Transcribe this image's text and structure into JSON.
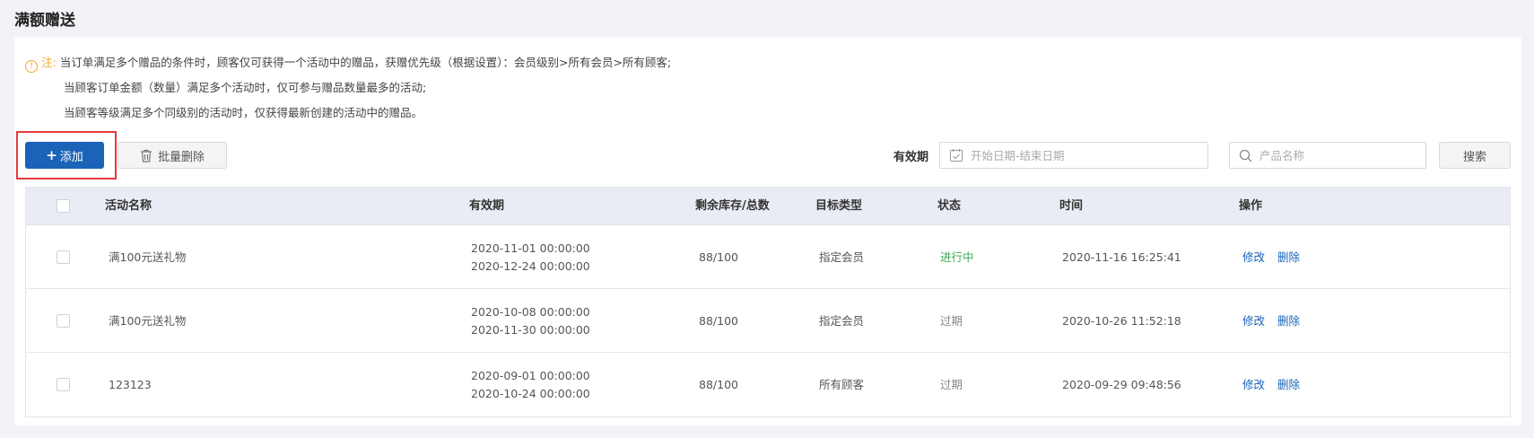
{
  "page": {
    "title": "满额赠送"
  },
  "notice": {
    "icon": "warning-circle-icon",
    "label": "注:",
    "line1": "当订单满足多个赠品的条件时，顾客仅可获得一个活动中的赠品，获赠优先级（根据设置）：会员级别>所有会员>所有顾客;",
    "line2": "当顾客订单金额（数量）满足多个活动时，仅可参与赠品数量最多的活动;",
    "line3": "当顾客等级满足多个同级别的活动时，仅获得最新创建的活动中的赠品。"
  },
  "toolbar": {
    "add_label": "添加",
    "batch_delete_label": "批量删除",
    "validity_label": "有效期",
    "date_placeholder": "开始日期-结束日期",
    "search_placeholder": "产品名称",
    "search_button": "搜索"
  },
  "table": {
    "columns": [
      "活动名称",
      "有效期",
      "剩余库存/总数",
      "目标类型",
      "状态",
      "时间",
      "操作"
    ],
    "rows": [
      {
        "name": "满100元送礼物",
        "start": "2020-11-01 00:00:00",
        "end": "2020-12-24 00:00:00",
        "stock": "88/100",
        "target": "指定会员",
        "status": "进行中",
        "time": "2020-11-16 16:25:41",
        "edit": "修改",
        "delete": "删除"
      },
      {
        "name": "满100元送礼物",
        "start": "2020-10-08 00:00:00",
        "end": "2020-11-30 00:00:00",
        "stock": "88/100",
        "target": "指定会员",
        "status": "过期",
        "time": "2020-10-26 11:52:18",
        "edit": "修改",
        "delete": "删除"
      },
      {
        "name": "123123",
        "start": "2020-09-01 00:00:00",
        "end": "2020-10-24 00:00:00",
        "stock": "88/100",
        "target": "所有顾客",
        "status": "过期",
        "time": "2020-09-29 09:48:56",
        "edit": "修改",
        "delete": "删除"
      }
    ]
  },
  "colors": {
    "primary": "#1a63b8",
    "active": "#3fab53",
    "warning": "#f5a623",
    "highlight": "#e43a3a"
  }
}
